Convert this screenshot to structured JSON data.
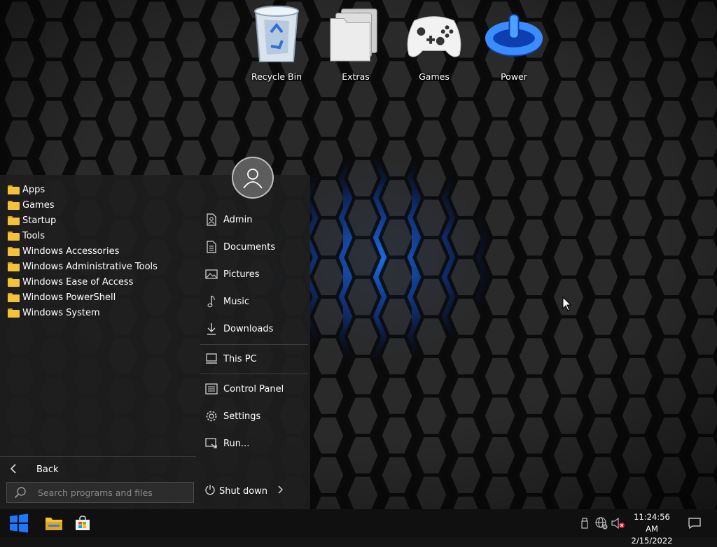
{
  "desktop": {
    "icons": [
      {
        "label": "Recycle Bin",
        "icon": "recycle-bin-icon"
      },
      {
        "label": "Extras",
        "icon": "folder-stack-icon"
      },
      {
        "label": "Games",
        "icon": "gamepad-icon"
      },
      {
        "label": "Power",
        "icon": "power-icon"
      }
    ]
  },
  "start_menu": {
    "programs": [
      {
        "label": "Apps"
      },
      {
        "label": "Games"
      },
      {
        "label": "Startup"
      },
      {
        "label": "Tools"
      },
      {
        "label": "Windows Accessories"
      },
      {
        "label": "Windows Administrative Tools"
      },
      {
        "label": "Windows Ease of Access"
      },
      {
        "label": "Windows PowerShell"
      },
      {
        "label": "Windows System"
      }
    ],
    "back_label": "Back",
    "search_placeholder": "Search programs and files",
    "right_items": [
      {
        "label": "Admin",
        "icon": "user-document-icon"
      },
      {
        "label": "Documents",
        "icon": "document-icon"
      },
      {
        "label": "Pictures",
        "icon": "picture-icon"
      },
      {
        "label": "Music",
        "icon": "music-note-icon"
      },
      {
        "label": "Downloads",
        "icon": "download-icon"
      },
      {
        "label": "This PC",
        "icon": "computer-icon"
      },
      {
        "label": "Control Panel",
        "icon": "control-panel-icon"
      },
      {
        "label": "Settings",
        "icon": "gear-icon"
      },
      {
        "label": "Run...",
        "icon": "run-icon"
      }
    ],
    "shutdown_label": "Shut down"
  },
  "taskbar": {
    "time": "11:24:56 AM",
    "date": "2/15/2022"
  },
  "colors": {
    "accent_blue": "#1e78ff",
    "folder_yellow": "#f3c23b",
    "menu_bg": "#1e1e1e",
    "taskbar_bg": "#101010"
  }
}
